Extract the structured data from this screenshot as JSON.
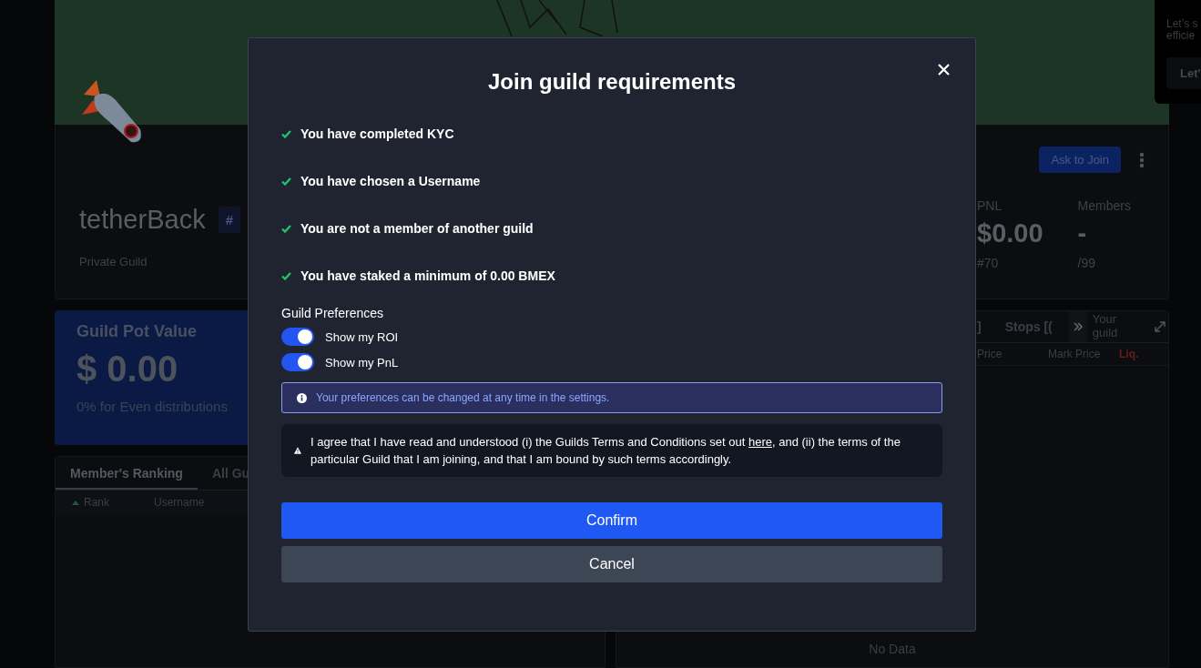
{
  "guild": {
    "name": "tetherBack",
    "tag": "#",
    "type": "Private Guild",
    "join_button": "Ask to Join",
    "stats": [
      {
        "label": "PNL",
        "value": "$0.00",
        "sub": "#70"
      },
      {
        "label": "Members",
        "value": "-",
        "sub": "/99"
      }
    ]
  },
  "pot": {
    "title": "Guild Pot Value",
    "value": "$ 0.00",
    "note": "0% for Even distributions"
  },
  "ranking": {
    "tabs": [
      {
        "label": "Member's Ranking",
        "selected": true
      },
      {
        "label": "All Gu",
        "selected": false
      }
    ],
    "columns": [
      "Rank",
      "Username"
    ]
  },
  "positions": {
    "tabs": [
      "]",
      "Stops [("
    ],
    "guild_label": "Your guild",
    "columns": [
      {
        "label": "Price",
        "kind": "plain"
      },
      {
        "label": "Mark Price",
        "kind": "plain"
      },
      {
        "label": "Liq.",
        "kind": "alert"
      }
    ],
    "empty": "No Data"
  },
  "welcome": {
    "lines": [
      "Let’s s",
      "efficie"
    ],
    "button": "Let'"
  },
  "modal": {
    "title": "Join guild requirements",
    "requirements": [
      {
        "text": "You have completed KYC",
        "met": true
      },
      {
        "text": "You have chosen a Username",
        "met": true
      },
      {
        "text": "You are not a member of another guild",
        "met": true
      },
      {
        "text": "You have staked a minimum of 0.00 BMEX",
        "met": true
      }
    ],
    "preferences_label": "Guild Preferences",
    "preferences": [
      {
        "label": "Show my ROI",
        "on": true
      },
      {
        "label": "Show my PnL",
        "on": true
      }
    ],
    "notice": "Your preferences can be changed at any time in the settings.",
    "agreement": {
      "before": "I agree that I have read and understood (i) the Guilds Terms and Conditions set out ",
      "link": "here",
      "after": ", and (ii) the terms of the particular Guild that I am joining, and that I am bound by such terms accordingly."
    },
    "confirm": "Confirm",
    "cancel": "Cancel"
  }
}
